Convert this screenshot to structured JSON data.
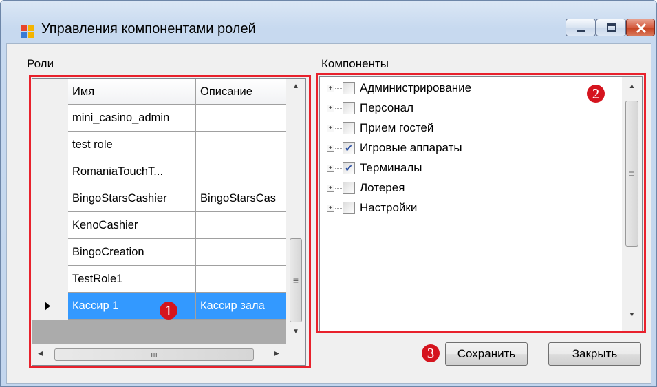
{
  "window": {
    "title": "Управления компонентами ролей",
    "accent_color": "#e8212c"
  },
  "roles": {
    "label": "Роли",
    "columns": [
      "Имя",
      "Описание"
    ],
    "rows": [
      {
        "name": "mini_casino_admin",
        "description": ""
      },
      {
        "name": "test role",
        "description": ""
      },
      {
        "name": "RomaniaTouchT...",
        "description": ""
      },
      {
        "name": "BingoStarsCashier",
        "description": "BingoStarsCas"
      },
      {
        "name": "KenoCashier",
        "description": ""
      },
      {
        "name": "BingoCreation",
        "description": ""
      },
      {
        "name": "TestRole1",
        "description": ""
      },
      {
        "name": "Кассир 1",
        "description": "Кассир зала",
        "selected": true
      }
    ],
    "hscroll_mark": "ııı"
  },
  "components": {
    "label": "Компоненты",
    "items": [
      {
        "label": "Администрирование",
        "checked": false
      },
      {
        "label": "Персонал",
        "checked": false
      },
      {
        "label": "Прием гостей",
        "checked": false
      },
      {
        "label": "Игровые аппараты",
        "checked": true
      },
      {
        "label": "Терминалы",
        "checked": true
      },
      {
        "label": "Лотерея",
        "checked": false
      },
      {
        "label": "Настройки",
        "checked": false
      }
    ]
  },
  "buttons": {
    "save": "Сохранить",
    "close": "Закрыть"
  },
  "badges": {
    "one": "1",
    "two": "2",
    "three": "3"
  }
}
